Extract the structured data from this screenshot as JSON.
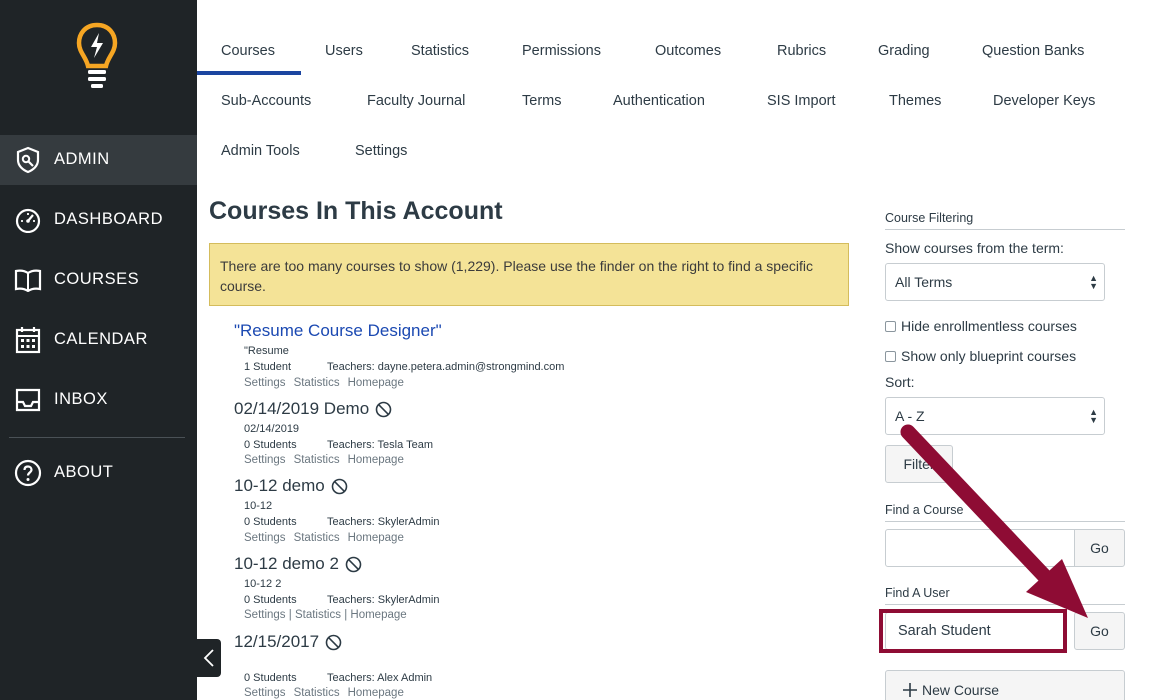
{
  "sidebar": {
    "items": [
      {
        "label": "ADMIN",
        "icon": "admin-shield-icon"
      },
      {
        "label": "DASHBOARD",
        "icon": "dashboard-gauge-icon"
      },
      {
        "label": "COURSES",
        "icon": "book-icon"
      },
      {
        "label": "CALENDAR",
        "icon": "calendar-icon"
      },
      {
        "label": "INBOX",
        "icon": "inbox-icon"
      },
      {
        "label": "ABOUT",
        "icon": "help-icon"
      }
    ],
    "active": "ADMIN"
  },
  "tabs": [
    "Courses",
    "Users",
    "Statistics",
    "Permissions",
    "Outcomes",
    "Rubrics",
    "Grading",
    "Question Banks",
    "Sub-Accounts",
    "Faculty Journal",
    "Terms",
    "Authentication",
    "SIS Import",
    "Themes",
    "Developer Keys",
    "Admin Tools",
    "Settings"
  ],
  "active_tab": "Courses",
  "main": {
    "title": "Courses In This Account",
    "alert": "There are too many courses to show (1,229). Please use the finder on the right to find a specific course."
  },
  "courses": [
    {
      "title": "\"Resume Course Designer\"",
      "code": "\"Resume",
      "students": "1 Student",
      "teachers": "Teachers: dayne.petera.admin@strongmind.com",
      "links": [
        "Settings",
        "Statistics",
        "Homepage"
      ],
      "sep": "",
      "concluded": false
    },
    {
      "title": "02/14/2019 Demo",
      "code": "02/14/2019",
      "students": "0 Students",
      "teachers": "Teachers: Tesla Team",
      "links": [
        "Settings",
        "Statistics",
        "Homepage"
      ],
      "sep": "",
      "concluded": true
    },
    {
      "title": "10-12 demo",
      "code": "10-12",
      "students": "0 Students",
      "teachers": "Teachers: SkylerAdmin",
      "links": [
        "Settings",
        "Statistics",
        "Homepage"
      ],
      "sep": "",
      "concluded": true
    },
    {
      "title": "10-12 demo 2",
      "code": "10-12 2",
      "students": "0 Students",
      "teachers": "Teachers: SkylerAdmin",
      "links": [
        "Settings",
        "Statistics",
        "Homepage"
      ],
      "sep": "|",
      "concluded": true
    },
    {
      "title": "12/15/2017",
      "code": "",
      "students": "0 Students",
      "teachers": "Teachers: Alex Admin",
      "links": [
        "Settings",
        "Statistics",
        "Homepage"
      ],
      "sep": "",
      "concluded": true
    }
  ],
  "filter": {
    "heading": "Course Filtering",
    "term_label": "Show courses from the term:",
    "term_value": "All Terms",
    "hide_enrollmentless": "Hide enrollmentless courses",
    "blueprint_only": "Show only blueprint courses",
    "sort_label": "Sort:",
    "sort_value": "A - Z",
    "filter_button": "Filter"
  },
  "find_course": {
    "heading": "Find a Course",
    "value": "",
    "go": "Go"
  },
  "find_user": {
    "heading": "Find A User",
    "value": "Sarah Student",
    "go": "Go"
  },
  "new_course": {
    "label": "New Course",
    "icon": "plus-icon"
  },
  "colors": {
    "sidebar": "#1f2427",
    "sidebar_active": "#353b3f",
    "accent": "#1b45a0",
    "link": "#1b49b2",
    "alert_bg": "#f4e397",
    "annotation": "#8e0c34",
    "logo": "#f6a623"
  }
}
